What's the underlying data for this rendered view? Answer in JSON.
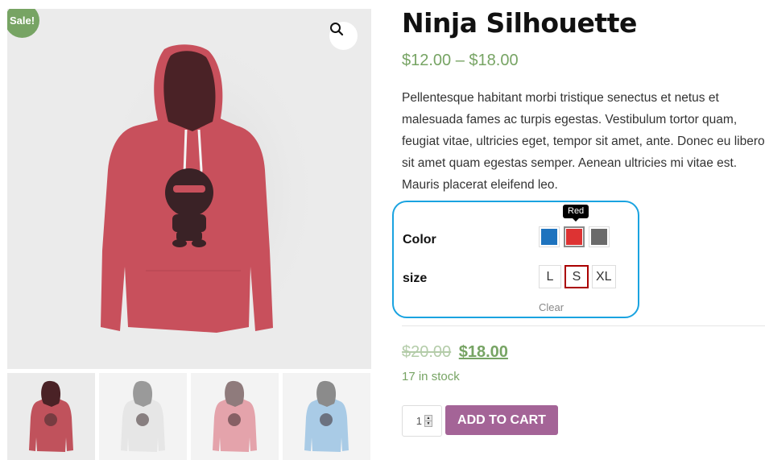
{
  "gallery": {
    "sale_badge": "Sale!",
    "zoom_icon": "magnifier-icon",
    "main_image": {
      "subject": "red hoodie with ninja print",
      "color": "#c8505c"
    },
    "thumbnails": [
      {
        "label": "red-hoodie",
        "color": "#c0525c",
        "hood": "#4a2226",
        "active": true
      },
      {
        "label": "white-hoodie",
        "color": "#e6e6e6",
        "hood": "#9a9a9a",
        "active": false
      },
      {
        "label": "pink-hoodie",
        "color": "#e4a3ab",
        "hood": "#8f7b7c",
        "active": false
      },
      {
        "label": "blue-hoodie",
        "color": "#a9cbe6",
        "hood": "#8b8b8b",
        "active": false
      }
    ]
  },
  "product": {
    "title": "Ninja Silhouette",
    "price_range": "$12.00 – $18.00",
    "description": "Pellentesque habitant morbi tristique senectus et netus et malesuada fames ac turpis egestas. Vestibulum tortor quam, feugiat vitae, ultricies eget, tempor sit amet, ante. Donec eu libero sit amet quam egestas semper. Aenean ultricies mi vitae est. Mauris placerat eleifend leo."
  },
  "variations": {
    "color_label": "Color",
    "size_label": "size",
    "tooltip": "Red",
    "colors": [
      {
        "name": "Blue",
        "hex": "#1e73be",
        "selected": false
      },
      {
        "name": "Red",
        "hex": "#dd3333",
        "selected": true
      },
      {
        "name": "Gray",
        "hex": "#6b6b6b",
        "selected": false
      }
    ],
    "sizes": [
      {
        "label": "L",
        "selected": false
      },
      {
        "label": "S",
        "selected": true
      },
      {
        "label": "XL",
        "selected": false
      }
    ],
    "clear_label": "Clear",
    "highlight_color": "#1aa3e0"
  },
  "purchase": {
    "old_price": "$20.00",
    "new_price": "$18.00",
    "stock": "17 in stock",
    "quantity": "1",
    "add_to_cart_label": "ADD TO CART",
    "button_color": "#a46497",
    "accent_color": "#77a464"
  }
}
